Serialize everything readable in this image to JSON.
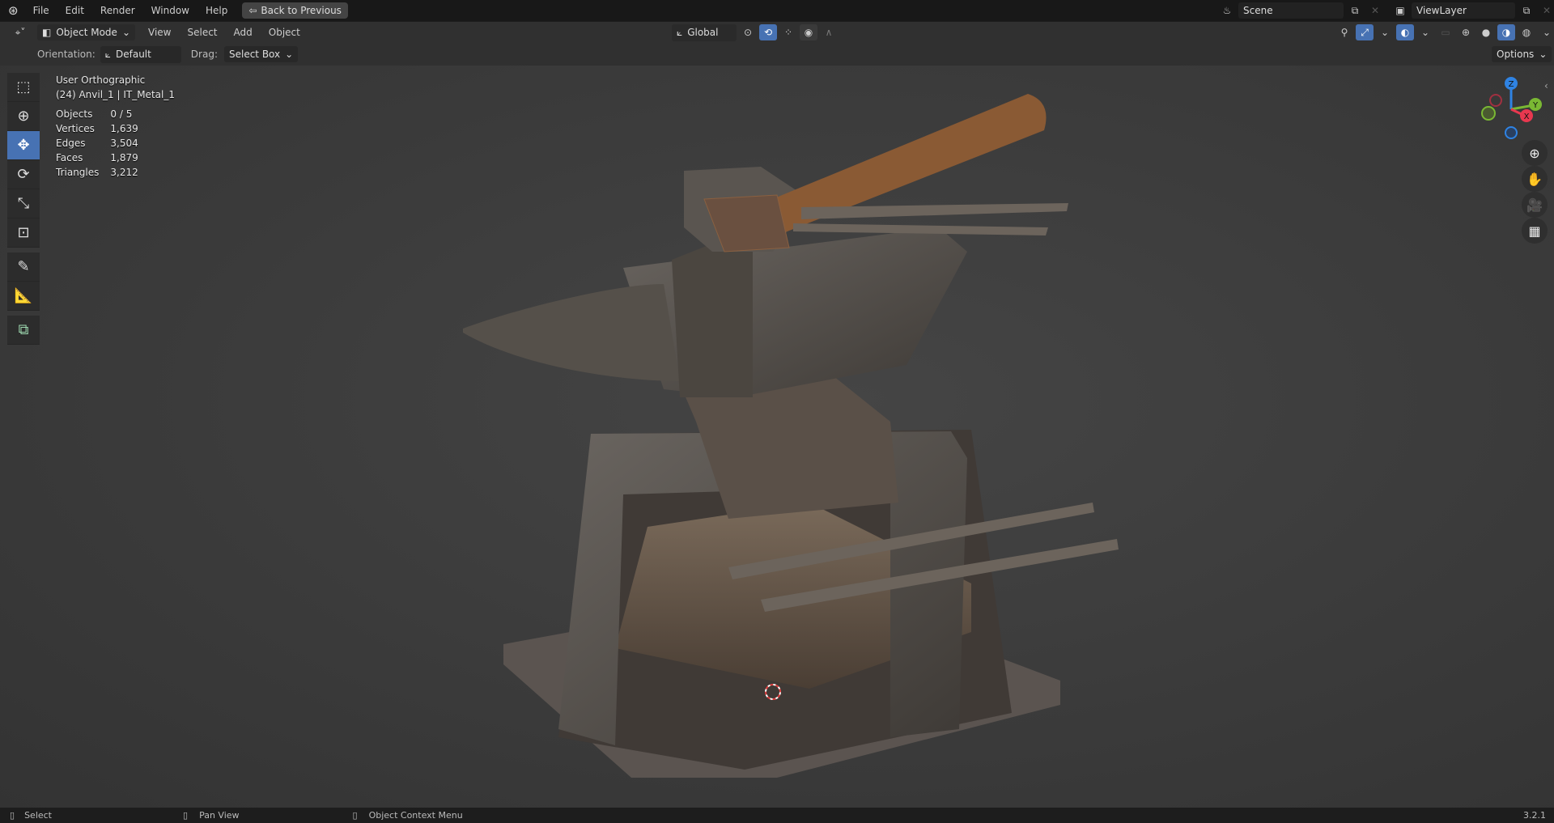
{
  "topbar": {
    "menus": [
      "File",
      "Edit",
      "Render",
      "Window",
      "Help"
    ],
    "back_label": "Back to Previous",
    "scene": "Scene",
    "view_layer": "ViewLayer"
  },
  "header": {
    "mode": "Object Mode",
    "menus": [
      "View",
      "Select",
      "Add",
      "Object"
    ],
    "transform_orientation": "Global"
  },
  "tool_settings": {
    "orientation_label": "Orientation:",
    "orientation_value": "Default",
    "drag_label": "Drag:",
    "drag_value": "Select Box",
    "options_label": "Options"
  },
  "overlay": {
    "view_name": "User Orthographic",
    "object_info": "(24) Anvil_1 | IT_Metal_1",
    "stats": [
      {
        "label": "Objects",
        "value": "0 / 5"
      },
      {
        "label": "Vertices",
        "value": "1,639"
      },
      {
        "label": "Edges",
        "value": "3,504"
      },
      {
        "label": "Faces",
        "value": "1,879"
      },
      {
        "label": "Triangles",
        "value": "3,212"
      }
    ]
  },
  "gizmo": {
    "z": "Z",
    "y": "Y",
    "x": "X"
  },
  "statusbar": {
    "select": "Select",
    "pan": "Pan View",
    "context": "Object Context Menu",
    "version": "3.2.1"
  },
  "colors": {
    "accent": "#4772b3",
    "x_axis": "#e8384f",
    "y_axis": "#7ab833",
    "z_axis": "#2f83e3"
  }
}
